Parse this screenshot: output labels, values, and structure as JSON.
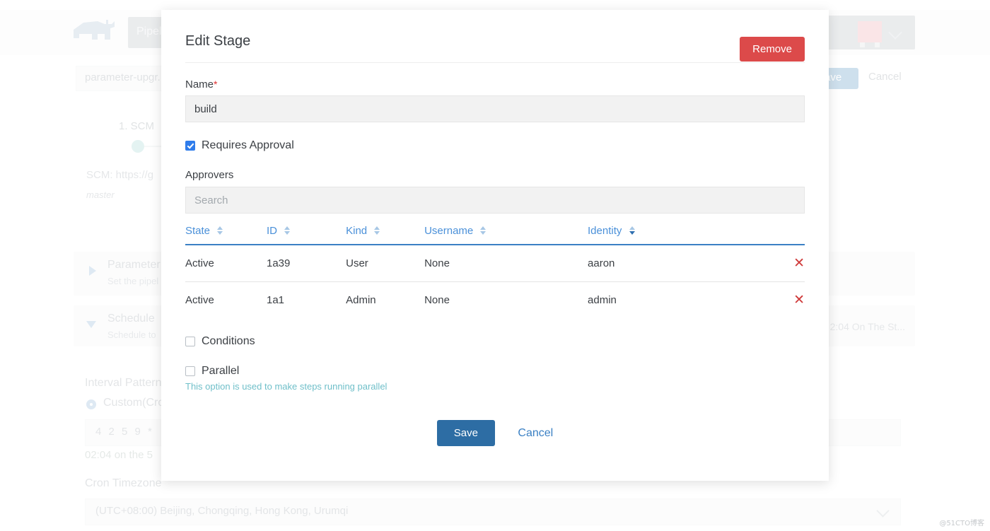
{
  "background": {
    "logo_icon": "rhino-logo-icon",
    "tab_label": "Pipeli...",
    "pipeline_name_value": "parameter-upgr...",
    "header_save_label": "ave",
    "header_cancel_label": "Cancel",
    "avatar_icon": "user-avatar",
    "avatar_chevron_icon": "chevron-down-icon",
    "scm_step_title": "1. SCM",
    "scm_url_text": "SCM: https://g",
    "scm_branch_text": "master",
    "cards": [
      {
        "title": "Parameter",
        "subtitle": "Set the pipel",
        "right_text": ""
      },
      {
        "title": "Schedule",
        "subtitle": "Schedule to",
        "right_text": "2:04 On The St..."
      }
    ],
    "interval_pattern_label": "Interval Pattern",
    "radio_label": "Custom(Cro",
    "cron_value": "4 2 5 9 *",
    "cron_hint": "02:04 on the 5",
    "cron_timezone_label": "Cron Timezone",
    "cron_timezone_value": "(UTC+08:00) Beijing, Chongqing, Hong Kong, Urumqi",
    "timezone_chevron_icon": "chevron-down-icon"
  },
  "modal": {
    "title": "Edit Stage",
    "remove_label": "Remove",
    "name": {
      "label": "Name",
      "required_marker": "*",
      "value": "build",
      "placeholder": ""
    },
    "requires_approval": {
      "label": "Requires Approval",
      "checked": true
    },
    "approvers": {
      "label": "Approvers",
      "search_placeholder": "Search",
      "search_value": "",
      "columns": [
        {
          "label": "State",
          "sort": "none"
        },
        {
          "label": "ID",
          "sort": "none"
        },
        {
          "label": "Kind",
          "sort": "none"
        },
        {
          "label": "Username",
          "sort": "none"
        },
        {
          "label": "Identity",
          "sort": "desc"
        }
      ],
      "rows": [
        {
          "state": "Active",
          "id": "1a39",
          "kind": "User",
          "username": "None",
          "identity": "aaron",
          "remove_icon": "close-x-icon"
        },
        {
          "state": "Active",
          "id": "1a1",
          "kind": "Admin",
          "username": "None",
          "identity": "admin",
          "remove_icon": "close-x-icon"
        }
      ]
    },
    "conditions": {
      "label": "Conditions",
      "checked": false
    },
    "parallel": {
      "label": "Parallel",
      "checked": false,
      "hint": "This option is used to make steps running parallel"
    },
    "save_label": "Save",
    "cancel_label": "Cancel"
  },
  "watermark": "@51CTO博客",
  "colors": {
    "accent_blue": "#2d6da4",
    "link_blue": "#3b80c4",
    "danger_red": "#dc4a4a",
    "success_green": "#3fa34d",
    "hint_teal": "#6fbfc9",
    "checkbox_blue": "#2f7ceb"
  }
}
